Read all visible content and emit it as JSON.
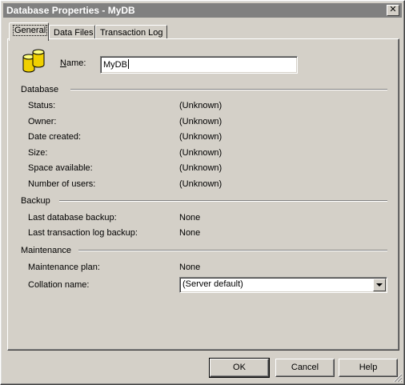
{
  "window": {
    "title": "Database Properties - MyDB",
    "close_glyph": "✕"
  },
  "tabs": [
    {
      "label": "General",
      "active": true
    },
    {
      "label": "Data Files",
      "active": false
    },
    {
      "label": "Transaction Log",
      "active": false
    }
  ],
  "general": {
    "icon": "database-icon",
    "name_label": "Name:",
    "name_value": "MyDB",
    "database": {
      "heading": "Database",
      "rows": [
        {
          "label": "Status:",
          "value": "(Unknown)"
        },
        {
          "label": "Owner:",
          "value": "(Unknown)"
        },
        {
          "label": "Date created:",
          "value": "(Unknown)"
        },
        {
          "label": "Size:",
          "value": "(Unknown)"
        },
        {
          "label": "Space available:",
          "value": "(Unknown)"
        },
        {
          "label": "Number of users:",
          "value": "(Unknown)"
        }
      ]
    },
    "backup": {
      "heading": "Backup",
      "rows": [
        {
          "label": "Last database backup:",
          "value": "None"
        },
        {
          "label": "Last transaction log backup:",
          "value": "None"
        }
      ]
    },
    "maintenance": {
      "heading": "Maintenance",
      "plan_label": "Maintenance plan:",
      "plan_value": "None",
      "collation_label": "Collation name:",
      "collation_value": "(Server default)"
    }
  },
  "buttons": {
    "ok": "OK",
    "cancel": "Cancel",
    "help": "Help"
  },
  "colors": {
    "titlebar": "#808080",
    "face": "#d4d0c8",
    "db_icon": "#f0d000"
  }
}
